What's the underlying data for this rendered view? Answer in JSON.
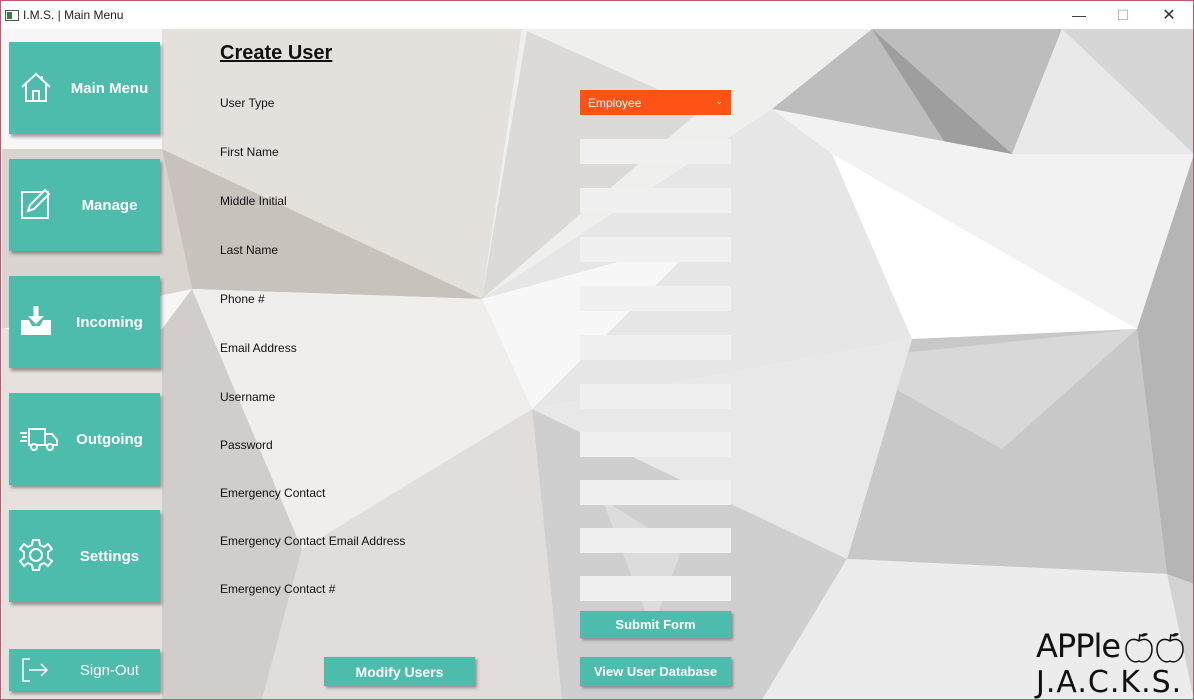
{
  "window": {
    "title": "I.M.S. | Main Menu",
    "min_glyph": "—",
    "max_glyph": "☐",
    "close_glyph": "✕"
  },
  "sidebar": {
    "items": [
      {
        "label": "Main Menu",
        "icon": "home-icon"
      },
      {
        "label": "Manage",
        "icon": "edit-icon"
      },
      {
        "label": "Incoming",
        "icon": "inbox-download-icon"
      },
      {
        "label": "Outgoing",
        "icon": "delivery-truck-icon"
      },
      {
        "label": "Settings",
        "icon": "gear-icon"
      }
    ],
    "signout_label": "Sign-Out"
  },
  "form": {
    "heading": "Create User",
    "user_type_label": "User Type",
    "user_type_value": "Employee",
    "fields": [
      {
        "label": "First Name",
        "value": ""
      },
      {
        "label": "Middle Initial",
        "value": ""
      },
      {
        "label": "Last Name",
        "value": ""
      },
      {
        "label": "Phone #",
        "value": ""
      },
      {
        "label": "Email Address",
        "value": ""
      },
      {
        "label": "Username",
        "value": ""
      },
      {
        "label": "Password",
        "value": ""
      },
      {
        "label": "Emergency Contact",
        "value": ""
      },
      {
        "label": "Emergency Contact Email Address",
        "value": ""
      },
      {
        "label": "Emergency Contact #",
        "value": ""
      }
    ],
    "submit_label": "Submit Form",
    "modify_users_label": "Modify Users",
    "view_db_label": "View User Database"
  },
  "logo": {
    "line1": "APPle",
    "line2": "J.A.C.K.S."
  },
  "colors": {
    "accent_teal": "#4ebcac",
    "select_orange": "#fe5315",
    "field_bg": "#f0f0f0"
  }
}
